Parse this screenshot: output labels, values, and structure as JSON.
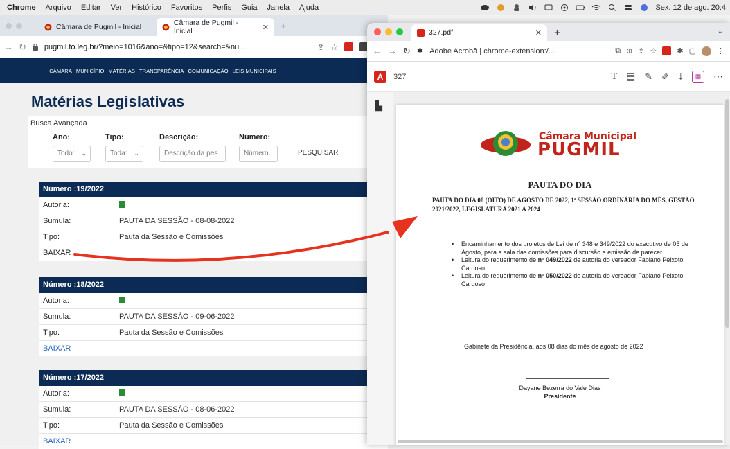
{
  "menubar": {
    "app": "Chrome",
    "items": [
      "Arquivo",
      "Editar",
      "Ver",
      "Histórico",
      "Favoritos",
      "Perfis",
      "Guia",
      "Janela",
      "Ajuda"
    ],
    "clock": "Sex. 12 de ago. 20:4"
  },
  "left_browser": {
    "tabs": [
      {
        "label": "Câmara de Pugmil - Inicial"
      },
      {
        "label": "Câmara de Pugmil - Inicial"
      }
    ],
    "url_host": "pugmil.to.leg.br",
    "url_rest": "/?meio=1016&ano=&tipo=12&search=&nu...",
    "nav": [
      "CÂMARA",
      "MUNICÍPIO",
      "MATÉRIAS",
      "TRANSPARÊNCIA",
      "COMUNICAÇÃO",
      "LEIS MUNICIPAIS"
    ],
    "page_title": "Matérias Legislativas",
    "search": {
      "heading": "Busca Avançada",
      "ano_label": "Ano:",
      "ano_value": "Todo:",
      "tipo_label": "Tipo:",
      "tipo_value": "Toda:",
      "descricao_label": "Descrição:",
      "descricao_placeholder": "Descrição da pes",
      "numero_label": "Número:",
      "numero_placeholder": "Número",
      "pesquisar": "PESQUISAR"
    },
    "cards": [
      {
        "header": "Número :19/2022",
        "autoria_label": "Autoria:",
        "sumula_label": "Sumula:",
        "sumula": "PAUTA DA SESSÃO - 08-08-2022",
        "tipo_label": "Tipo:",
        "tipo": "Pauta da Sessão e Comissões",
        "baixar": "BAIXAR"
      },
      {
        "header": "Número :18/2022",
        "autoria_label": "Autoria:",
        "sumula_label": "Sumula:",
        "sumula": "PAUTA DA SESSÃO - 09-06-2022",
        "tipo_label": "Tipo:",
        "tipo": "Pauta da Sessão e Comissões",
        "baixar": "BAIXAR"
      },
      {
        "header": "Número :17/2022",
        "autoria_label": "Autoria:",
        "sumula_label": "Sumula:",
        "sumula": "PAUTA DA SESSÃO - 08-06-2022",
        "tipo_label": "Tipo:",
        "tipo": "Pauta da Sessão e Comissões",
        "baixar": "BAIXAR"
      }
    ]
  },
  "right_browser": {
    "tab_label": "327.pdf",
    "url": "Adobe Acrobâ | chrome-extension:/...",
    "doc_name": "327",
    "pdf": {
      "logo_small": "Câmara Municipal",
      "logo_big": "PUGMIL",
      "title": "PAUTA DO DIA",
      "subtitle": "PAUTA DO DIA 08 (OITO) DE AGOSTO DE 2022, 1ª SESSÃO ORDINÁRIA DO MÊS, GESTÃO 2021/2022, LEGISLATURA 2021 A 2024",
      "bullet1": "Encaminhamento dos projetos de Lei de n° 348 e 349/2022 do executivo de 05 de Agosto, para a sala das comissões para discursão e emissão de parecer.",
      "bullet2_pre": "Leitura do requerimento de ",
      "bullet2_bold": "n° 049/2022",
      "bullet2_post": " de autoria do vereador Fabiano Peixoto Cardoso",
      "bullet3_pre": "Leitura do requerimento de ",
      "bullet3_bold": "n° 050/2022",
      "bullet3_post": " de autoria do vereador Fabiano Peixoto Cardoso",
      "gabinete": "Gabinete da Presidência, aos 08 dias do mês de agosto de 2022",
      "signer": "Dayane Bezerra do Vale Dias",
      "role": "Presidente"
    }
  },
  "colors": {
    "navy": "#0b2b54",
    "acrobat_red": "#d6261c",
    "arrow": "#e5331f",
    "status_green": "#2e8b35"
  }
}
